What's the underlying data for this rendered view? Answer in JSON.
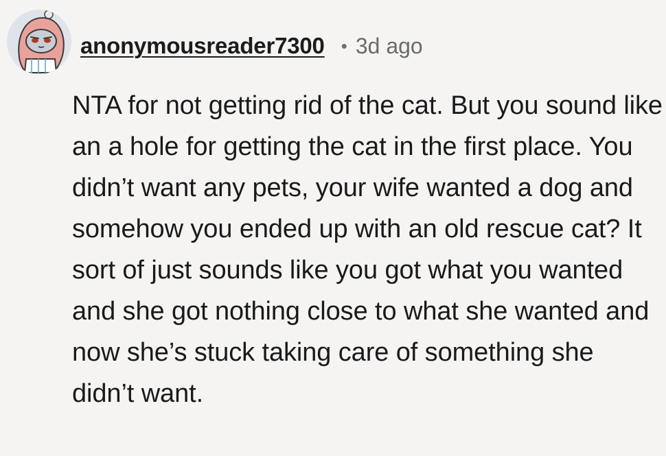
{
  "comment": {
    "author": "anonymousreader7300",
    "separator": "•",
    "timestamp": "3d ago",
    "avatar_icon": "snoo-avatar-icon",
    "body": "NTA for not getting rid of the cat. But you sound like an a hole for getting the cat in the first place. You didn’t want any pets, your wife wanted a dog and somehow you ended up with an old rescue cat? It sort of just sounds like you got what you wanted and she got nothing close to what she wanted and now she’s stuck taking care of something she didn’t want."
  },
  "colors": {
    "background": "#f5f4f3",
    "text": "#1a1a1a",
    "muted": "#6a6a6a",
    "avatar_hood": "#e9a19c",
    "avatar_bg": "#dfe3ea"
  }
}
